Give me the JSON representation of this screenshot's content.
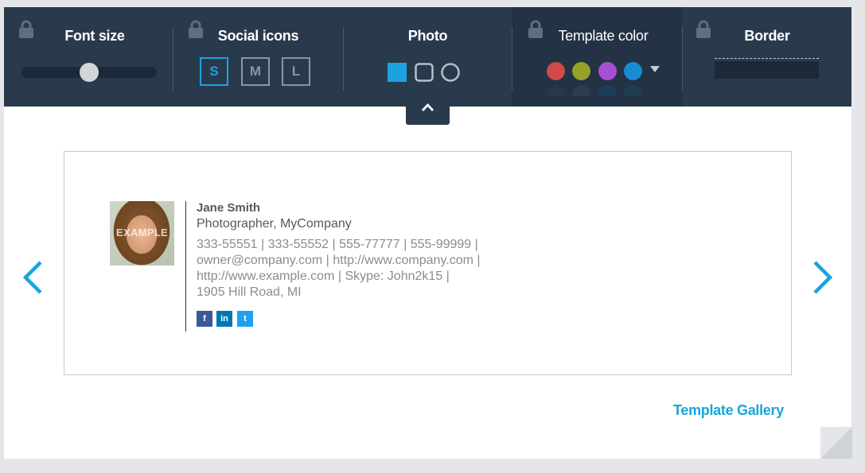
{
  "toolbar": {
    "font_size": {
      "title": "Font size",
      "value_fraction": 0.5
    },
    "social_icons": {
      "title": "Social icons",
      "sizes": [
        "S",
        "M",
        "L"
      ],
      "selected": "S"
    },
    "photo": {
      "title": "Photo",
      "shapes": [
        "square-filled",
        "rounded-square",
        "circle"
      ],
      "selected": "square-filled"
    },
    "template_color": {
      "title": "Template color",
      "colors": [
        "#d1494a",
        "#97a027",
        "#a74fd3",
        "#1a8ad1"
      ]
    },
    "border": {
      "title": "Border"
    }
  },
  "signature": {
    "photo_watermark": "EXAMPLE",
    "name": "Jane Smith",
    "title_line": "Photographer, MyCompany",
    "lines": [
      "333-55551 | 333-55552 | 555-77777 | 555-99999 |",
      "owner@company.com | http://www.company.com |",
      "http://www.example.com | Skype: John2k15 |",
      "1905 Hill Road, MI"
    ],
    "social": [
      {
        "label": "f",
        "icon": "facebook-icon",
        "color": "#3b5998"
      },
      {
        "label": "in",
        "icon": "linkedin-icon",
        "color": "#0077b5"
      },
      {
        "label": "t",
        "icon": "twitter-icon",
        "color": "#1da1f2"
      }
    ]
  },
  "footer": {
    "gallery_link": "Template Gallery"
  },
  "colors": {
    "accent": "#1aa3e0",
    "toolbar_bg": "#2a3a4d",
    "link": "#19a6d8"
  }
}
